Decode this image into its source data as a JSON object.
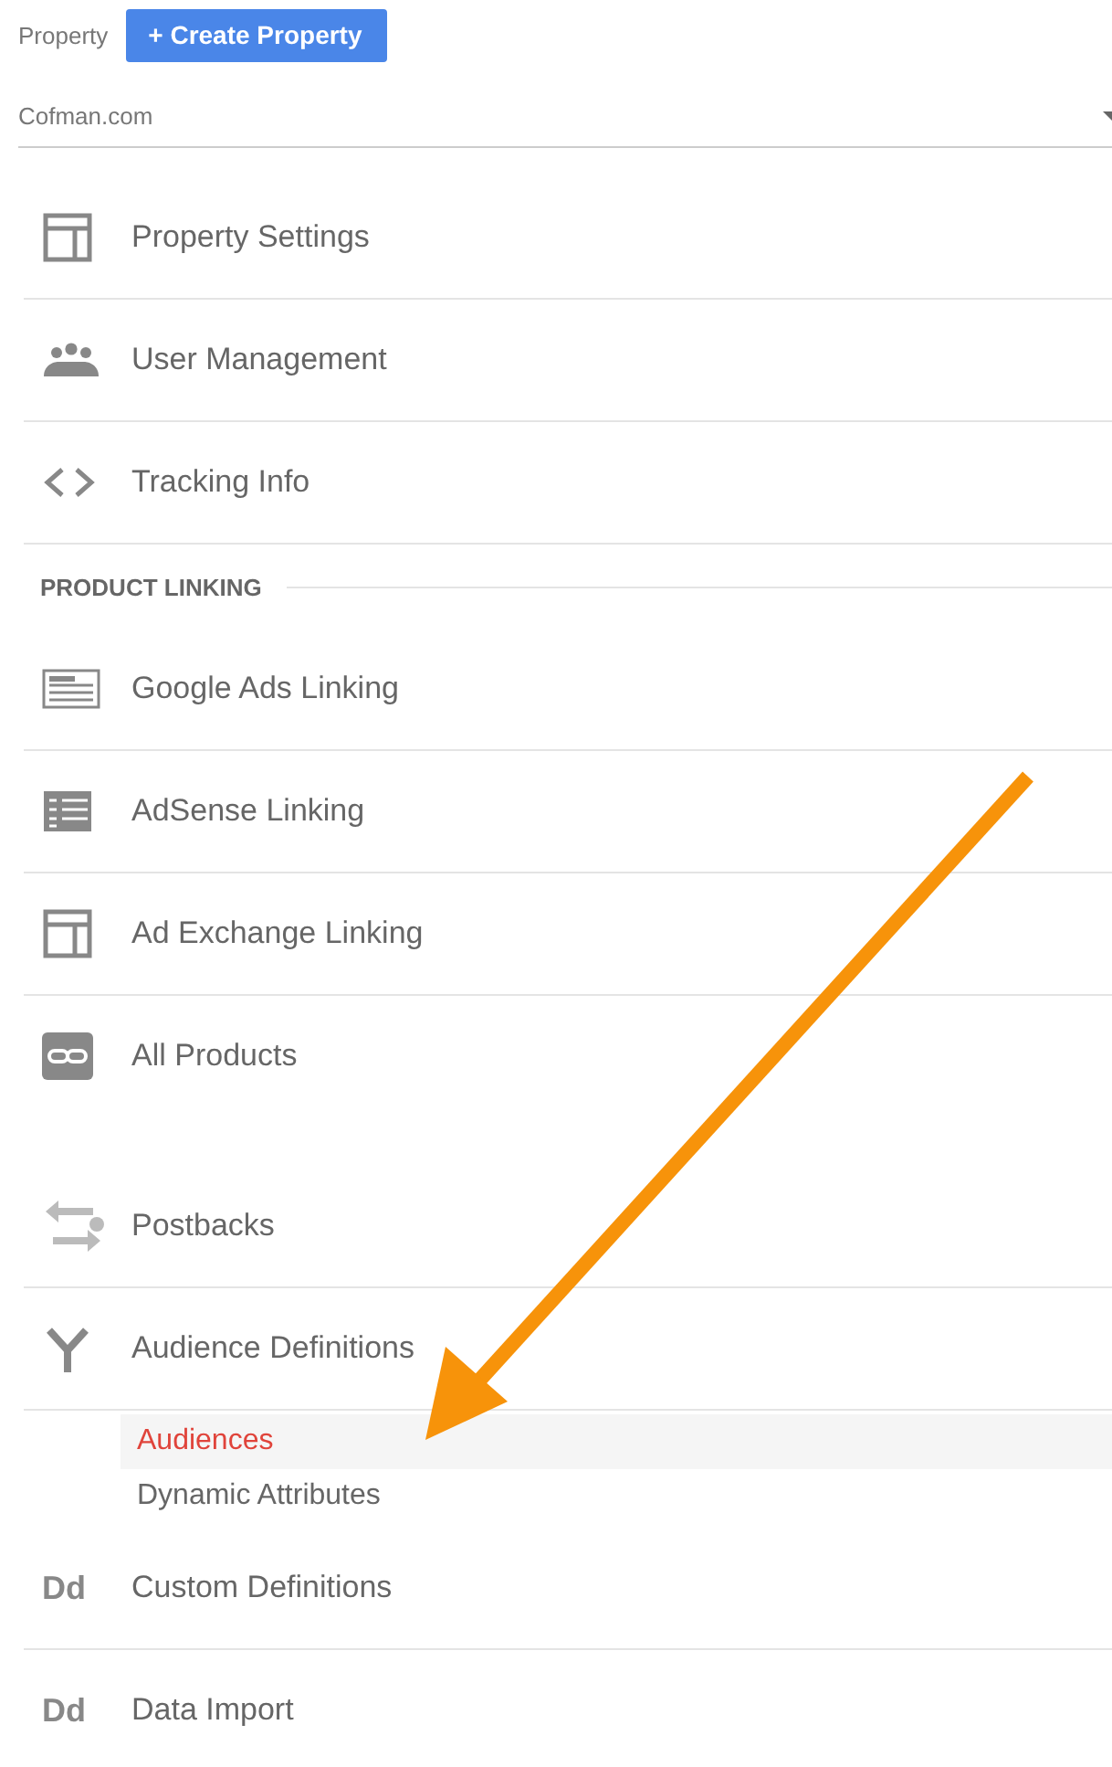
{
  "property": {
    "label": "Property",
    "create_button": "+ Create Property",
    "dropdown_value": "Cofman.com"
  },
  "groups": [
    {
      "items": [
        {
          "label": "Property Settings"
        },
        {
          "label": "User Management"
        },
        {
          "label": "Tracking Info"
        }
      ]
    },
    {
      "header": "PRODUCT LINKING",
      "items": [
        {
          "label": "Google Ads Linking"
        },
        {
          "label": "AdSense Linking"
        },
        {
          "label": "Ad Exchange Linking"
        },
        {
          "label": "All Products"
        }
      ]
    },
    {
      "items": [
        {
          "label": "Postbacks"
        },
        {
          "label": "Audience Definitions",
          "children": [
            {
              "label": "Audiences",
              "selected": true
            },
            {
              "label": "Dynamic Attributes",
              "selected": false
            }
          ]
        },
        {
          "label": "Custom Definitions",
          "badge": "Dd"
        },
        {
          "label": "Data Import",
          "badge": "Dd"
        }
      ]
    }
  ]
}
